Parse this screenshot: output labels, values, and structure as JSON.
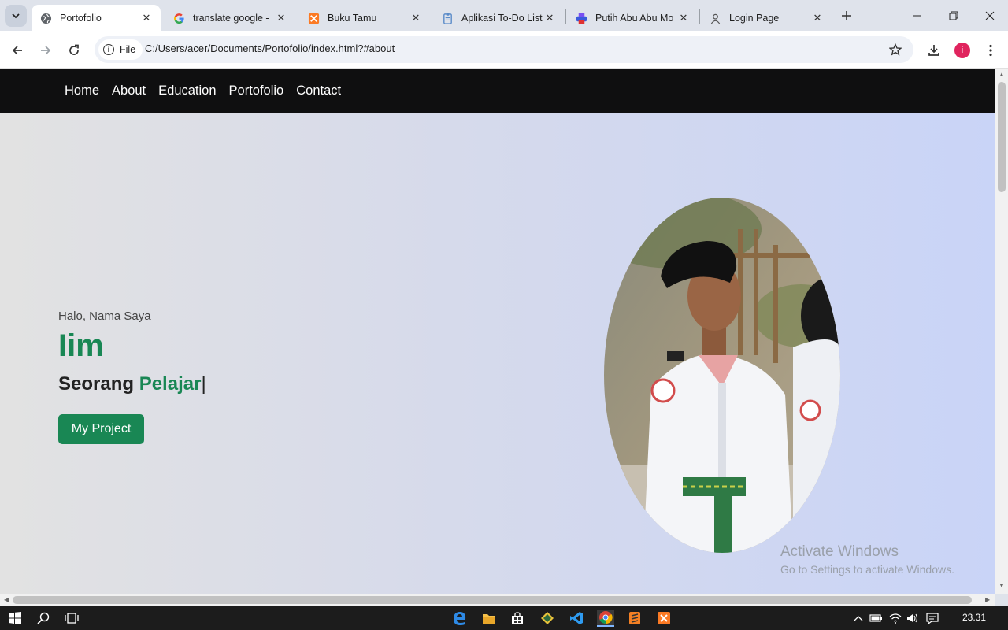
{
  "browser": {
    "tabs": [
      {
        "title": "Portofolio",
        "active": true,
        "icon": "globe-icon"
      },
      {
        "title": "translate google - ",
        "active": false,
        "icon": "google-icon"
      },
      {
        "title": "Buku Tamu",
        "active": false,
        "icon": "xampp-icon"
      },
      {
        "title": "Aplikasi To-Do List",
        "active": false,
        "icon": "clipboard-icon"
      },
      {
        "title": "Putih Abu Abu Mo",
        "active": false,
        "icon": "printer-icon"
      },
      {
        "title": "Login Page",
        "active": false,
        "icon": "user-icon"
      }
    ],
    "url_scheme_chip": "File",
    "url": "C:/Users/acer/Documents/Portofolio/index.html?#about",
    "profile_initial": "i"
  },
  "site": {
    "nav": [
      "Home",
      "About",
      "Education",
      "Portofolio",
      "Contact"
    ],
    "hero": {
      "greeting": "Halo, Nama Saya",
      "name": "Iim",
      "role_prefix": "Seorang",
      "role_accent": "Pelajar",
      "caret": "|",
      "cta": "My Project"
    },
    "colors": {
      "accent": "#198754",
      "nav_bg": "#0f0f10"
    }
  },
  "watermark": {
    "line1": "Activate Windows",
    "line2": "Go to Settings to activate Windows."
  },
  "taskbar": {
    "clock": "23.31"
  }
}
